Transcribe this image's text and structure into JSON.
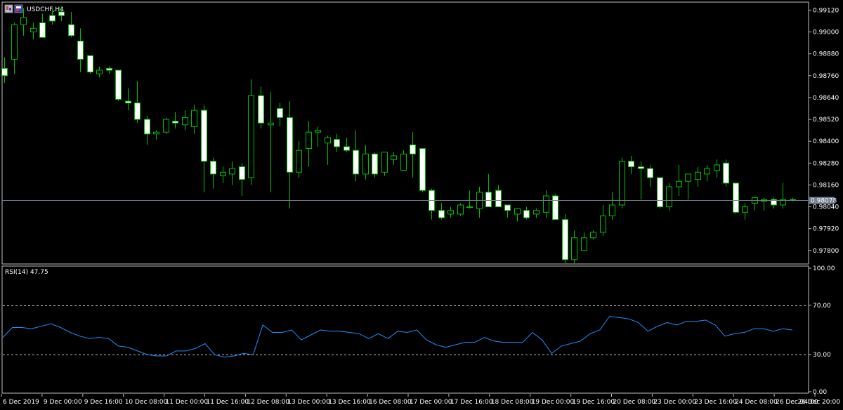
{
  "window": {
    "symbol_title": "USDCHF,H4",
    "current_price": "0.98078"
  },
  "indicator": {
    "title": "RSI(14) 47.75"
  },
  "colors": {
    "background": "#000000",
    "frame": "#c0c0c0",
    "bull_candle": "#000000",
    "bull_outline": "#00c000",
    "bear_candle": "#ffffff",
    "wick": "#00c000",
    "bid_line": "#708090",
    "rsi_line": "#1e90ff",
    "rsi_levels": "#c0c0c0",
    "axis_text": "#ffffff",
    "price_label_bg": "#708090"
  },
  "icons": [
    "chart-window-icon",
    "chart-window-icon-2"
  ],
  "chart_data": [
    {
      "type": "candlestick",
      "title": "USDCHF,H4",
      "price_axis_ticks": [
        "0.99120",
        "0.99000",
        "0.98880",
        "0.98760",
        "0.98640",
        "0.98520",
        "0.98400",
        "0.98280",
        "0.98160",
        "0.98040",
        "0.97920",
        "0.97800"
      ],
      "time_axis_labels": [
        "6 Dec 2019",
        "9 Dec 00:00",
        "9 Dec 16:00",
        "10 Dec 08:00",
        "11 Dec 00:00",
        "11 Dec 16:00",
        "12 Dec 08:00",
        "13 Dec 00:00",
        "13 Dec 16:00",
        "16 Dec 08:00",
        "17 Dec 00:00",
        "17 Dec 16:00",
        "18 Dec 08:00",
        "19 Dec 00:00",
        "19 Dec 16:00",
        "20 Dec 08:00",
        "23 Dec 00:00",
        "23 Dec 16:00",
        "24 Dec 08:00",
        "26 Dec 04:00",
        "26 Dec 20:00"
      ],
      "ylim": [
        0.9773,
        0.9916
      ],
      "current_price": 0.98078,
      "candles": [
        [
          0.988,
          0.9886,
          0.9872,
          0.9876
        ],
        [
          0.9885,
          0.9905,
          0.9877,
          0.9904
        ],
        [
          0.9904,
          0.9913,
          0.9898,
          0.9908
        ],
        [
          0.99,
          0.9905,
          0.9896,
          0.9902
        ],
        [
          0.9905,
          0.991,
          0.9897,
          0.9897
        ],
        [
          0.9909,
          0.9913,
          0.9904,
          0.9906
        ],
        [
          0.9911,
          0.9914,
          0.9906,
          0.9909
        ],
        [
          0.9904,
          0.9911,
          0.9897,
          0.9898
        ],
        [
          0.9895,
          0.9902,
          0.9878,
          0.9885
        ],
        [
          0.9887,
          0.9887,
          0.9877,
          0.9878
        ],
        [
          0.9877,
          0.9881,
          0.9875,
          0.9879
        ],
        [
          0.988,
          0.9881,
          0.9877,
          0.9879
        ],
        [
          0.9879,
          0.9879,
          0.9862,
          0.9863
        ],
        [
          0.9862,
          0.9869,
          0.9857,
          0.9861
        ],
        [
          0.9861,
          0.9873,
          0.985,
          0.9852
        ],
        [
          0.9852,
          0.9854,
          0.9838,
          0.9844
        ],
        [
          0.9844,
          0.9846,
          0.9841,
          0.9845
        ],
        [
          0.9845,
          0.9853,
          0.9844,
          0.9852
        ],
        [
          0.9851,
          0.9856,
          0.9847,
          0.985
        ],
        [
          0.9849,
          0.9857,
          0.9846,
          0.9853
        ],
        [
          0.9848,
          0.986,
          0.9844,
          0.9857
        ],
        [
          0.9857,
          0.986,
          0.9812,
          0.9829
        ],
        [
          0.9829,
          0.9831,
          0.9814,
          0.9822
        ],
        [
          0.9821,
          0.9826,
          0.9817,
          0.9823
        ],
        [
          0.9822,
          0.9829,
          0.9816,
          0.9825
        ],
        [
          0.9826,
          0.9828,
          0.981,
          0.9819
        ],
        [
          0.982,
          0.9874,
          0.9816,
          0.9865
        ],
        [
          0.9865,
          0.987,
          0.9847,
          0.985
        ],
        [
          0.9849,
          0.9867,
          0.9812,
          0.985
        ],
        [
          0.9858,
          0.9861,
          0.9848,
          0.9853
        ],
        [
          0.9853,
          0.9862,
          0.9803,
          0.9823
        ],
        [
          0.9823,
          0.984,
          0.982,
          0.9835
        ],
        [
          0.9836,
          0.9851,
          0.9826,
          0.9845
        ],
        [
          0.9845,
          0.9848,
          0.9837,
          0.9846
        ],
        [
          0.9839,
          0.9843,
          0.9827,
          0.9842
        ],
        [
          0.9841,
          0.9844,
          0.9834,
          0.9837
        ],
        [
          0.9837,
          0.9842,
          0.9834,
          0.9835
        ],
        [
          0.9835,
          0.9846,
          0.9818,
          0.9822
        ],
        [
          0.9822,
          0.9838,
          0.9819,
          0.9833
        ],
        [
          0.9833,
          0.9834,
          0.982,
          0.9822
        ],
        [
          0.9823,
          0.9834,
          0.9821,
          0.9834
        ],
        [
          0.983,
          0.9834,
          0.9827,
          0.9832
        ],
        [
          0.9824,
          0.9835,
          0.9824,
          0.9833
        ],
        [
          0.9838,
          0.9845,
          0.982,
          0.9833
        ],
        [
          0.9836,
          0.9836,
          0.9812,
          0.9813
        ],
        [
          0.9813,
          0.9814,
          0.9797,
          0.9802
        ],
        [
          0.9802,
          0.9806,
          0.9797,
          0.9798
        ],
        [
          0.98,
          0.9804,
          0.9798,
          0.9802
        ],
        [
          0.98,
          0.9806,
          0.9799,
          0.9805
        ],
        [
          0.9804,
          0.9813,
          0.9803,
          0.9804
        ],
        [
          0.9803,
          0.9815,
          0.9798,
          0.9812
        ],
        [
          0.9812,
          0.9822,
          0.9804,
          0.9804
        ],
        [
          0.9813,
          0.9816,
          0.9804,
          0.9804
        ],
        [
          0.9805,
          0.9805,
          0.9798,
          0.9802
        ],
        [
          0.98,
          0.9803,
          0.9796,
          0.9803
        ],
        [
          0.9802,
          0.9804,
          0.9797,
          0.9798
        ],
        [
          0.98,
          0.9803,
          0.9798,
          0.9802
        ],
        [
          0.9801,
          0.9813,
          0.9798,
          0.981
        ],
        [
          0.981,
          0.9811,
          0.9797,
          0.9797
        ],
        [
          0.9797,
          0.98,
          0.9773,
          0.9775
        ],
        [
          0.9775,
          0.9791,
          0.9773,
          0.9787
        ],
        [
          0.978,
          0.979,
          0.978,
          0.9787
        ],
        [
          0.9787,
          0.9791,
          0.9786,
          0.979
        ],
        [
          0.979,
          0.9805,
          0.9788,
          0.9799
        ],
        [
          0.9799,
          0.9812,
          0.9797,
          0.9805
        ],
        [
          0.9805,
          0.9831,
          0.9803,
          0.9829
        ],
        [
          0.9829,
          0.9832,
          0.9822,
          0.9826
        ],
        [
          0.9826,
          0.9829,
          0.9808,
          0.9825
        ],
        [
          0.9825,
          0.9827,
          0.9815,
          0.982
        ],
        [
          0.982,
          0.982,
          0.9803,
          0.9804
        ],
        [
          0.9804,
          0.9817,
          0.9802,
          0.9815
        ],
        [
          0.9815,
          0.9827,
          0.981,
          0.9818
        ],
        [
          0.9818,
          0.9822,
          0.9808,
          0.9822
        ],
        [
          0.9819,
          0.9826,
          0.9815,
          0.9823
        ],
        [
          0.9822,
          0.9827,
          0.9818,
          0.9825
        ],
        [
          0.9824,
          0.983,
          0.982,
          0.9827
        ],
        [
          0.9828,
          0.983,
          0.9815,
          0.9817
        ],
        [
          0.9817,
          0.9817,
          0.98,
          0.9801
        ],
        [
          0.9801,
          0.9806,
          0.9797,
          0.9804
        ],
        [
          0.9806,
          0.9808,
          0.9802,
          0.9809
        ],
        [
          0.9807,
          0.9809,
          0.9802,
          0.9808
        ],
        [
          0.9808,
          0.9809,
          0.9803,
          0.9805
        ],
        [
          0.9805,
          0.9817,
          0.9803,
          0.9808
        ],
        [
          0.9808,
          0.9809,
          0.9807,
          0.9808
        ]
      ]
    },
    {
      "type": "line",
      "title": "RSI(14) 47.75",
      "y_axis_ticks": [
        "100.00",
        "70.00",
        "30.00",
        "0.00"
      ],
      "ylim": [
        0,
        100
      ],
      "levels": [
        70,
        30
      ],
      "series": [
        {
          "values": [
            44,
            52,
            52,
            51,
            53,
            55,
            52,
            48,
            45,
            43,
            44,
            43,
            37,
            36,
            33,
            30,
            29,
            29,
            33,
            33,
            35,
            39,
            30,
            28,
            29,
            31,
            30,
            54,
            48,
            48,
            50,
            42,
            46,
            50,
            49,
            49,
            48,
            47,
            43,
            47,
            43,
            49,
            48,
            50,
            42,
            38,
            36,
            38,
            40,
            40,
            44,
            41,
            40,
            40,
            40,
            48,
            42,
            31,
            37,
            39,
            41,
            47,
            50,
            61,
            60,
            59,
            56,
            49,
            53,
            56,
            54,
            57,
            57,
            58,
            54,
            45,
            47,
            48,
            51,
            51,
            49,
            51,
            50
          ]
        }
      ]
    }
  ]
}
